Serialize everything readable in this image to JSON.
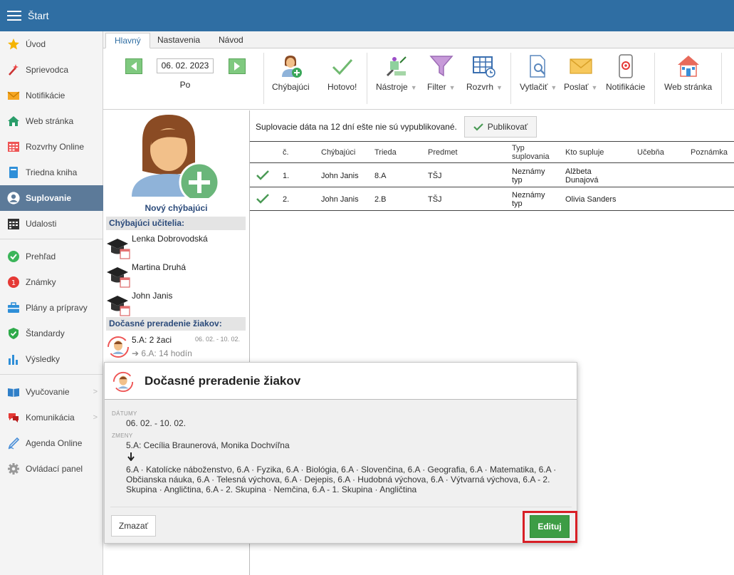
{
  "app": {
    "title": "Štart"
  },
  "sidebar": {
    "items": [
      {
        "label": "Úvod",
        "icon": "star-icon"
      },
      {
        "label": "Sprievodca",
        "icon": "magic-wand-icon"
      },
      {
        "label": "Notifikácie",
        "icon": "envelope-icon"
      },
      {
        "label": "Web stránka",
        "icon": "house-icon"
      },
      {
        "label": "Rozvrhy Online",
        "icon": "calendar-grid-icon"
      },
      {
        "label": "Triedna kniha",
        "icon": "book-icon"
      },
      {
        "label": "Suplovanie",
        "icon": "person-icon",
        "active": true
      },
      {
        "label": "Udalosti",
        "icon": "calendar-icon"
      },
      {
        "label": "Prehľad",
        "icon": "check-circle-icon"
      },
      {
        "label": "Známky",
        "icon": "grade-icon"
      },
      {
        "label": "Plány a prípravy",
        "icon": "briefcase-icon"
      },
      {
        "label": "Štandardy",
        "icon": "shield-check-icon"
      },
      {
        "label": "Výsledky",
        "icon": "bar-chart-icon"
      },
      {
        "label": "Vyučovanie",
        "icon": "open-book-icon",
        "chevron": ">"
      },
      {
        "label": "Komunikácia",
        "icon": "chat-icon",
        "chevron": ">"
      },
      {
        "label": "Agenda Online",
        "icon": "pen-icon"
      },
      {
        "label": "Ovládací panel",
        "icon": "gear-icon"
      }
    ]
  },
  "tabs": [
    {
      "label": "Hlavný",
      "active": true
    },
    {
      "label": "Nastavenia"
    },
    {
      "label": "Návod"
    }
  ],
  "toolbar": {
    "date": "06. 02. 2023",
    "day": "Po",
    "absent_label": "Chýbajúci",
    "done_label": "Hotovo!",
    "tools_label": "Nástroje",
    "filter_label": "Filter",
    "schedule_label": "Rozvrh",
    "print_label": "Vytlačiť",
    "send_label": "Poslať",
    "notifications_label": "Notifikácie",
    "web_label": "Web stránka",
    "dropdown_glyph": "▼"
  },
  "left": {
    "new_absent_label": "Nový chýbajúci",
    "absent_teachers_heading": "Chýbajúci učitelia:",
    "absent_teachers": [
      {
        "name": "Lenka Dobrovodská"
      },
      {
        "name": "Martina Druhá"
      },
      {
        "name": "John Janis"
      }
    ],
    "temp_reassign_heading": "Dočasné preradenie žiakov:",
    "temp_reassign": {
      "line1": "5.A: 2 žaci",
      "dates": "06. 02. - 10. 02.",
      "line2": "➔ 6.A: 14 hodín"
    }
  },
  "main": {
    "publish_message": "Suplovacie dáta na 12 dní ešte nie sú vypublikované.",
    "publish_button": "Publikovať",
    "table": {
      "headers": [
        "č.",
        "Chýbajúci",
        "Trieda",
        "Predmet",
        "Typ suplovania",
        "Kto supluje",
        "Učebňa",
        "Poznámka"
      ],
      "rows": [
        {
          "no": "1.",
          "absent": "John Janis",
          "class": "8.A",
          "subject": "TŠJ",
          "type": "Neznámy typ",
          "substitute": "Alžbeta Dunajová",
          "room": "",
          "note": ""
        },
        {
          "no": "2.",
          "absent": "John Janis",
          "class": "2.B",
          "subject": "TŠJ",
          "type": "Neznámy typ",
          "substitute": "Olivia Sanders",
          "room": "",
          "note": ""
        }
      ]
    }
  },
  "dialog": {
    "title": "Dočasné preradenie žiakov",
    "dates_label": "DÁTUMY",
    "dates_value": "06. 02. - 10. 02.",
    "changes_label": "ZMENY",
    "changes_from": "5.A: Cecília Braunerová, Monika Dochvíľna",
    "changes_to": "6.A · Katolícke náboženstvo, 6.A · Fyzika, 6.A · Biológia, 6.A · Slovenčina, 6.A · Geografia, 6.A · Matematika, 6.A · Občianska náuka, 6.A · Telesná výchova, 6.A · Dejepis, 6.A · Hudobná výchova, 6.A · Výtvarná výchova, 6.A - 2. Skupina · Angličtina, 6.A - 2. Skupina · Nemčina, 6.A - 1. Skupina · Angličtina",
    "delete_button": "Zmazať",
    "edit_button": "Edituj"
  },
  "colors": {
    "topbar": "#2f6ea3",
    "sidebar_active": "#5c7a99",
    "edit_button": "#3d9d45",
    "highlight": "#d81f26"
  }
}
